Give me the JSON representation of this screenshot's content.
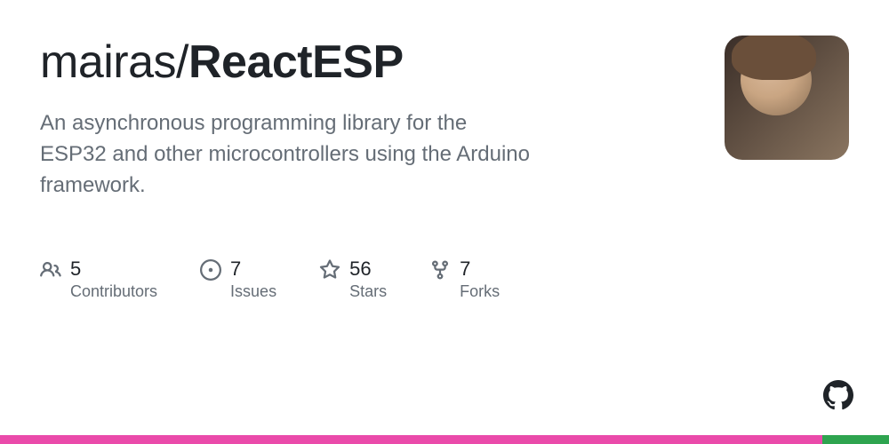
{
  "repo": {
    "owner": "mairas",
    "name": "ReactESP",
    "description": "An asynchronous programming library for the ESP32 and other microcontrollers using the Arduino framework."
  },
  "stats": {
    "contributors": {
      "value": "5",
      "label": "Contributors"
    },
    "issues": {
      "value": "7",
      "label": "Issues"
    },
    "stars": {
      "value": "56",
      "label": "Stars"
    },
    "forks": {
      "value": "7",
      "label": "Forks"
    }
  },
  "colors": {
    "stripe_primary": "#ea4aaa",
    "stripe_secondary": "#2ea44f"
  }
}
